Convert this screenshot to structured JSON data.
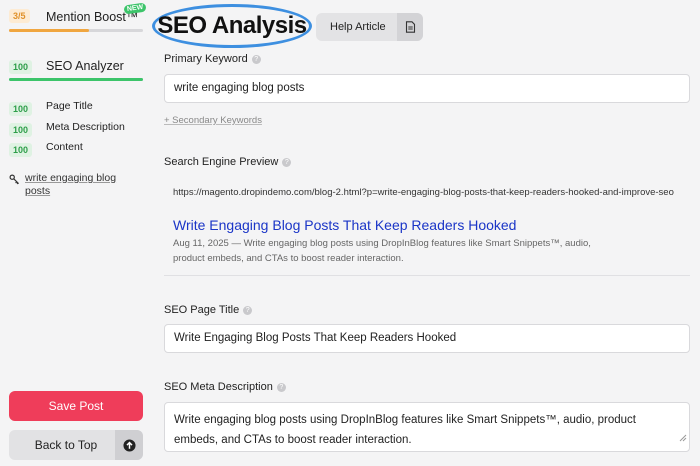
{
  "sidebar": {
    "mention_boost": {
      "score": "3/5",
      "label": "Mention Boost™",
      "badge": "NEW",
      "progress": 0.6
    },
    "seo_analyzer": {
      "score": "100",
      "label": "SEO Analyzer",
      "progress": 1.0
    },
    "sub_items": [
      {
        "score": "100",
        "label": "Page Title"
      },
      {
        "score": "100",
        "label": "Meta Description"
      },
      {
        "score": "100",
        "label": "Content"
      }
    ],
    "keyword": "write engaging blog posts",
    "save_label": "Save Post",
    "top_label": "Back to Top"
  },
  "header": {
    "title": "SEO Analysis",
    "help_label": "Help Article"
  },
  "primary_keyword": {
    "label": "Primary Keyword",
    "value": "write engaging blog posts",
    "secondary_link": "+ Secondary Keywords"
  },
  "preview": {
    "label": "Search Engine Preview",
    "url": "https://magento.dropindemo.com/blog-2.html?p=write-engaging-blog-posts-that-keep-readers-hooked-and-improve-seo",
    "title": "Write Engaging Blog Posts That Keep Readers Hooked",
    "desc": "Aug 11, 2025 — Write engaging blog posts using DropInBlog features like Smart Snippets™, audio, product embeds, and CTAs to boost reader interaction."
  },
  "page_title_field": {
    "label": "SEO Page Title",
    "value": "Write Engaging Blog Posts That Keep Readers Hooked"
  },
  "meta_field": {
    "label": "SEO Meta Description",
    "value": "Write engaging blog posts using DropInBlog features like Smart Snippets™, audio, product embeds, and CTAs to boost reader interaction."
  },
  "colors": {
    "accent": "#ef3d5a",
    "score_green": "#2e9e4a",
    "score_orange": "#e0912a",
    "link_blue": "#1a35c7",
    "highlight_ring": "#3d8fe0"
  },
  "icons": {
    "keyword": "key-icon",
    "help": "document-icon",
    "top": "arrow-up-circle-icon",
    "help_marker": "question-icon"
  }
}
